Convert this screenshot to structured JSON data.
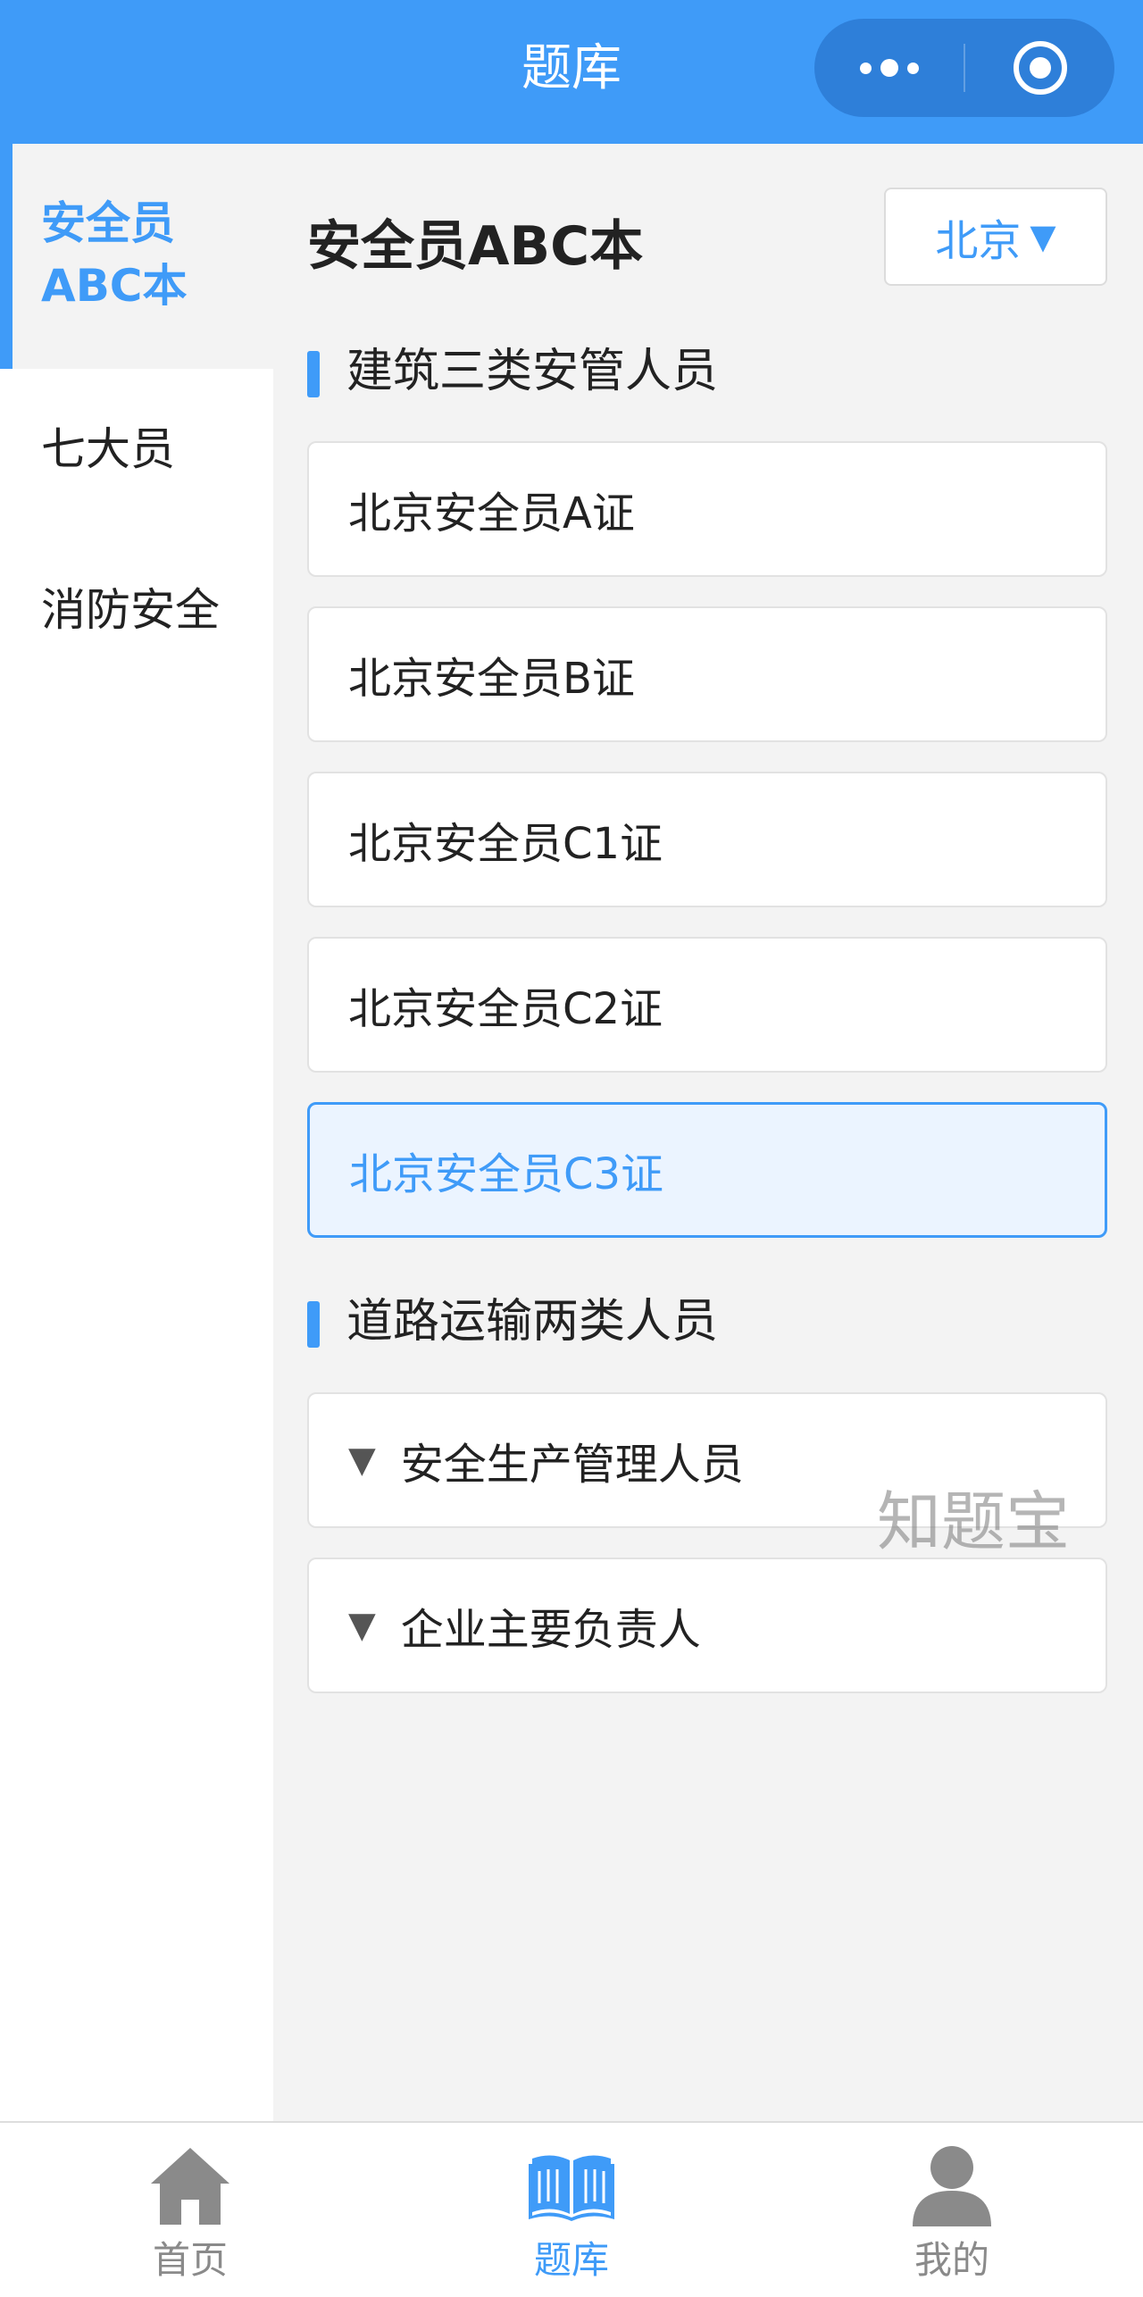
{
  "navbar": {
    "title": "题库",
    "menu_icon": "more-dots-icon",
    "close_icon": "target-circle-icon"
  },
  "sidebar": {
    "items": [
      {
        "label": "安全员ABC本",
        "active": true
      },
      {
        "label": "七大员",
        "active": false
      },
      {
        "label": "消防安全",
        "active": false
      }
    ]
  },
  "main": {
    "heading": "安全员ABC本",
    "region": {
      "value": "北京",
      "caret": "▼"
    },
    "sections": [
      {
        "title": "建筑三类安管人员",
        "items": [
          {
            "label": "北京安全员A证"
          },
          {
            "label": "北京安全员B证"
          },
          {
            "label": "北京安全员C1证"
          },
          {
            "label": "北京安全员C2证"
          },
          {
            "label": "北京安全员C3证",
            "selected": true
          }
        ]
      },
      {
        "title": "道路运输两类人员",
        "items": [
          {
            "label": "安全生产管理人员",
            "expandable": true
          },
          {
            "label": "企业主要负责人",
            "expandable": true
          }
        ]
      }
    ],
    "expand_marker": "▼"
  },
  "watermark": "知题宝",
  "tabbar": {
    "tabs": [
      {
        "label": "首页",
        "icon": "home-icon"
      },
      {
        "label": "题库",
        "icon": "book-icon",
        "active": true
      },
      {
        "label": "我的",
        "icon": "user-icon"
      }
    ]
  },
  "colors": {
    "accent": "#3f9bf8",
    "content_bg": "#f3f3f3",
    "selected_bg": "#ebf4ff",
    "tab_inactive": "#8a8a8a"
  }
}
